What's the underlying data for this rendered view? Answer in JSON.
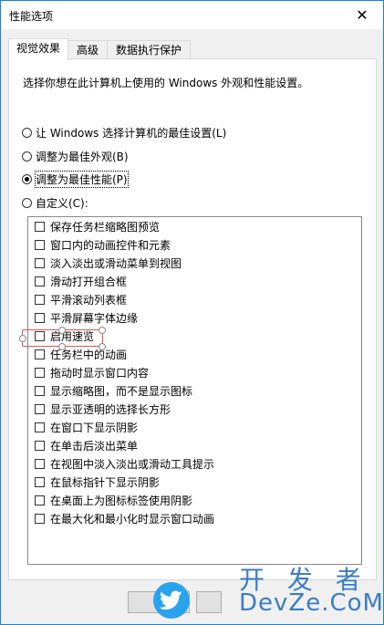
{
  "window": {
    "title": "性能选项",
    "close_glyph": "✕"
  },
  "tabs": [
    {
      "label": "视觉效果",
      "active": true
    },
    {
      "label": "高级",
      "active": false
    },
    {
      "label": "数据执行保护",
      "active": false
    }
  ],
  "description": "选择你想在此计算机上使用的 Windows 外观和性能设置。",
  "radios": [
    {
      "label": "让 Windows 选择计算机的最佳设置(L)",
      "checked": false
    },
    {
      "label": "调整为最佳外观(B)",
      "checked": false
    },
    {
      "label": "调整为最佳性能(P)",
      "checked": true
    },
    {
      "label": "自定义(C):",
      "checked": false
    }
  ],
  "effects": [
    {
      "label": "保存任务栏缩略图预览",
      "checked": false
    },
    {
      "label": "窗口内的动画控件和元素",
      "checked": false
    },
    {
      "label": "淡入淡出或滑动菜单到视图",
      "checked": false
    },
    {
      "label": "滑动打开组合框",
      "checked": false
    },
    {
      "label": "平滑滚动列表框",
      "checked": false
    },
    {
      "label": "平滑屏幕字体边缘",
      "checked": false
    },
    {
      "label": "启用速览",
      "checked": false
    },
    {
      "label": "任务栏中的动画",
      "checked": false
    },
    {
      "label": "拖动时显示窗口内容",
      "checked": false
    },
    {
      "label": "显示缩略图，而不是显示图标",
      "checked": false
    },
    {
      "label": "显示亚透明的选择长方形",
      "checked": false
    },
    {
      "label": "在窗口下显示阴影",
      "checked": false
    },
    {
      "label": "在单击后淡出菜单",
      "checked": false
    },
    {
      "label": "在视图中淡入淡出或滑动工具提示",
      "checked": false
    },
    {
      "label": "在鼠标指针下显示阴影",
      "checked": false
    },
    {
      "label": "在桌面上为图标标签使用阴影",
      "checked": false
    },
    {
      "label": "在最大化和最小化时显示窗口动画",
      "checked": false
    }
  ],
  "watermark": {
    "line1": "开 发 者",
    "line2": "DevZe.CoM"
  },
  "colors": {
    "accent": "#1883d7",
    "annotation": "#e05555",
    "watermark": "#3c7cc4"
  }
}
